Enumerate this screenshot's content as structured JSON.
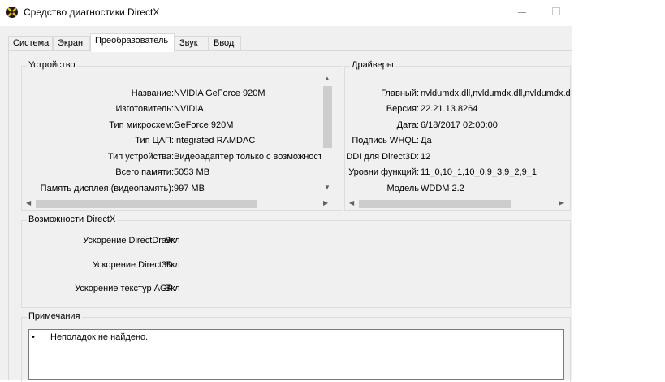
{
  "window": {
    "title": "Средство диагностики DirectX"
  },
  "tabs": [
    {
      "label": "Система"
    },
    {
      "label": "Экран"
    },
    {
      "label": "Преобразователь"
    },
    {
      "label": "Звук"
    },
    {
      "label": "Ввод"
    }
  ],
  "active_tab": "Преобразователь",
  "device": {
    "group_label": "Устройство",
    "rows": [
      {
        "label": "Название:",
        "value": "NVIDIA GeForce 920M"
      },
      {
        "label": "Изготовитель:",
        "value": "NVIDIA"
      },
      {
        "label": "Тип микросхем:",
        "value": "GeForce 920M"
      },
      {
        "label": "Тип ЦАП:",
        "value": "Integrated RAMDAC"
      },
      {
        "label": "Тип устройства:",
        "value": "Видеоадаптер только с возможност"
      },
      {
        "label": "Всего памяти:",
        "value": "5053 MB"
      },
      {
        "label": "Память дисплея (видеопамять):",
        "value": "997 MB"
      }
    ]
  },
  "drivers": {
    "group_label": "Драйверы",
    "rows": [
      {
        "label": "Главный:",
        "value": "nvldumdx.dll,nvldumdx.dll,nvldumdx.d"
      },
      {
        "label": "Версия:",
        "value": "22.21.13.8264"
      },
      {
        "label": "Дата:",
        "value": "6/18/2017 02:00:00"
      },
      {
        "label": "Подпись WHQL:",
        "value": "Да"
      },
      {
        "label": "DDI для Direct3D:",
        "value": "12"
      },
      {
        "label": "Уровни функций:",
        "value": "11_0,10_1,10_0,9_3,9_2,9_1"
      },
      {
        "label": "Модель",
        "value": "WDDM 2.2"
      }
    ]
  },
  "directx": {
    "group_label": "Возможности DirectX",
    "rows": [
      {
        "label": "Ускорение DirectDraw:",
        "value": "Вкл"
      },
      {
        "label": "Ускорение Direct3D:",
        "value": "Вкл"
      },
      {
        "label": "Ускорение текстур AGP:",
        "value": "Вкл"
      }
    ]
  },
  "notes": {
    "group_label": "Примечания",
    "items": [
      "Неполадок не найдено."
    ]
  },
  "icons": {
    "app": "directx-icon",
    "minimize": "minimize-icon",
    "maximize": "maximize-icon"
  }
}
